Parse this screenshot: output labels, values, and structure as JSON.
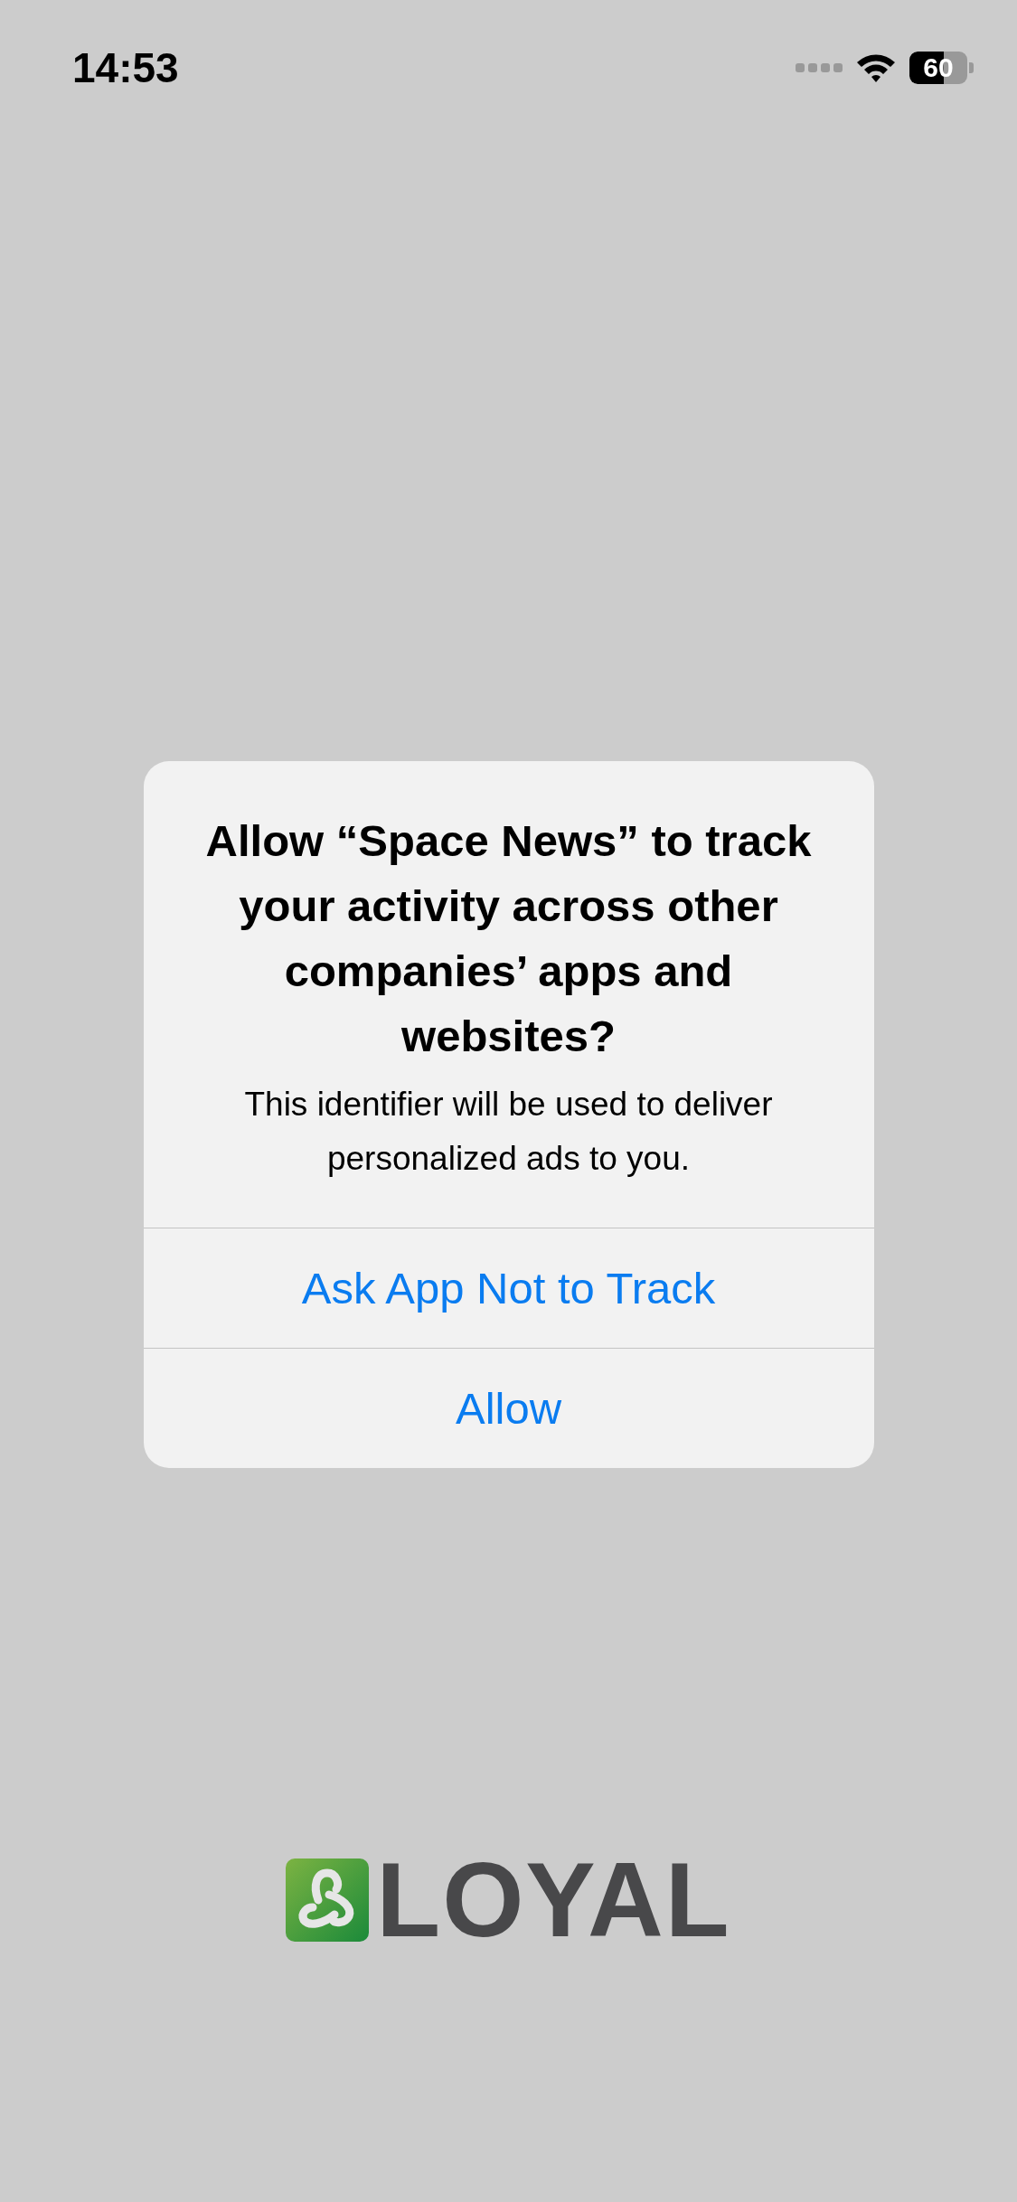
{
  "status_bar": {
    "time": "14:53",
    "battery": "60"
  },
  "alert": {
    "title": "Allow “Space News” to track your activity across other companies’ apps and websites?",
    "message": "This identifier will be used to deliver personalized ads to you.",
    "buttons": [
      {
        "label": "Ask App Not to Track"
      },
      {
        "label": "Allow"
      }
    ]
  },
  "logo": {
    "text": "LOYAL"
  }
}
